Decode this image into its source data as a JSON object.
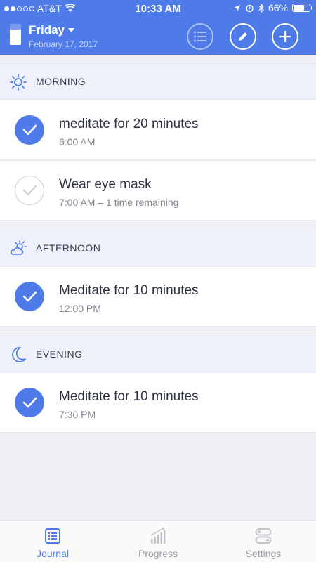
{
  "status_bar": {
    "carrier": "AT&T",
    "time": "10:33 AM",
    "battery": "66%",
    "battery_level": 0.66
  },
  "header": {
    "day": "Friday",
    "date": "February 17, 2017",
    "accent_color": "#4f7be8"
  },
  "sections": [
    {
      "title": "MORNING",
      "icon": "sun-icon",
      "items": [
        {
          "title": "meditate for 20 minutes",
          "subtitle": "6:00 AM",
          "done": true
        },
        {
          "title": "Wear eye mask",
          "subtitle": "7:00 AM – 1 time remaining",
          "done": false
        }
      ]
    },
    {
      "title": "AFTERNOON",
      "icon": "partly-cloudy-icon",
      "items": [
        {
          "title": "Meditate for 10 minutes",
          "subtitle": "12:00 PM",
          "done": true
        }
      ]
    },
    {
      "title": "EVENING",
      "icon": "moon-icon",
      "items": [
        {
          "title": "Meditate for 10 minutes",
          "subtitle": "7:30 PM",
          "done": true
        }
      ]
    }
  ],
  "tabbar": {
    "tabs": [
      {
        "label": "Journal",
        "icon": "journal-icon",
        "active": true
      },
      {
        "label": "Progress",
        "icon": "progress-chart-icon",
        "active": false
      },
      {
        "label": "Settings",
        "icon": "settings-toggles-icon",
        "active": false
      }
    ]
  }
}
